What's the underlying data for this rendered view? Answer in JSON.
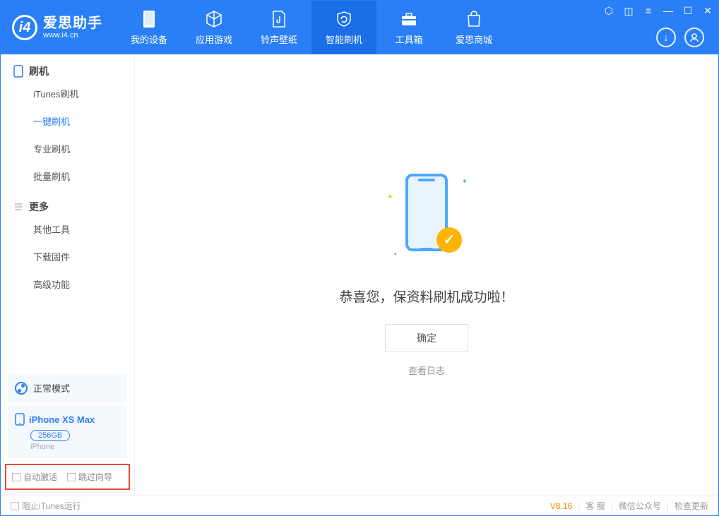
{
  "app": {
    "name_cn": "爱思助手",
    "name_en": "www.i4.cn"
  },
  "nav": {
    "items": [
      {
        "label": "我的设备"
      },
      {
        "label": "应用游戏"
      },
      {
        "label": "铃声壁纸"
      },
      {
        "label": "智能刷机"
      },
      {
        "label": "工具箱"
      },
      {
        "label": "爱思商城"
      }
    ]
  },
  "sidebar": {
    "section_flash": "刷机",
    "items_flash": [
      {
        "label": "iTunes刷机"
      },
      {
        "label": "一键刷机"
      },
      {
        "label": "专业刷机"
      },
      {
        "label": "批量刷机"
      }
    ],
    "section_more": "更多",
    "items_more": [
      {
        "label": "其他工具"
      },
      {
        "label": "下载固件"
      },
      {
        "label": "高级功能"
      }
    ],
    "mode_label": "正常模式",
    "device": {
      "name": "iPhone XS Max",
      "capacity": "256GB",
      "type": "iPhone"
    },
    "opt_auto_activate": "自动激活",
    "opt_skip_guide": "跳过向导"
  },
  "main": {
    "success_message": "恭喜您，保资料刷机成功啦！",
    "ok_button": "确定",
    "view_log": "查看日志"
  },
  "footer": {
    "block_itunes": "阻止iTunes运行",
    "version": "V8.16",
    "support": "客 服",
    "wechat": "微信公众号",
    "check_update": "检查更新"
  }
}
